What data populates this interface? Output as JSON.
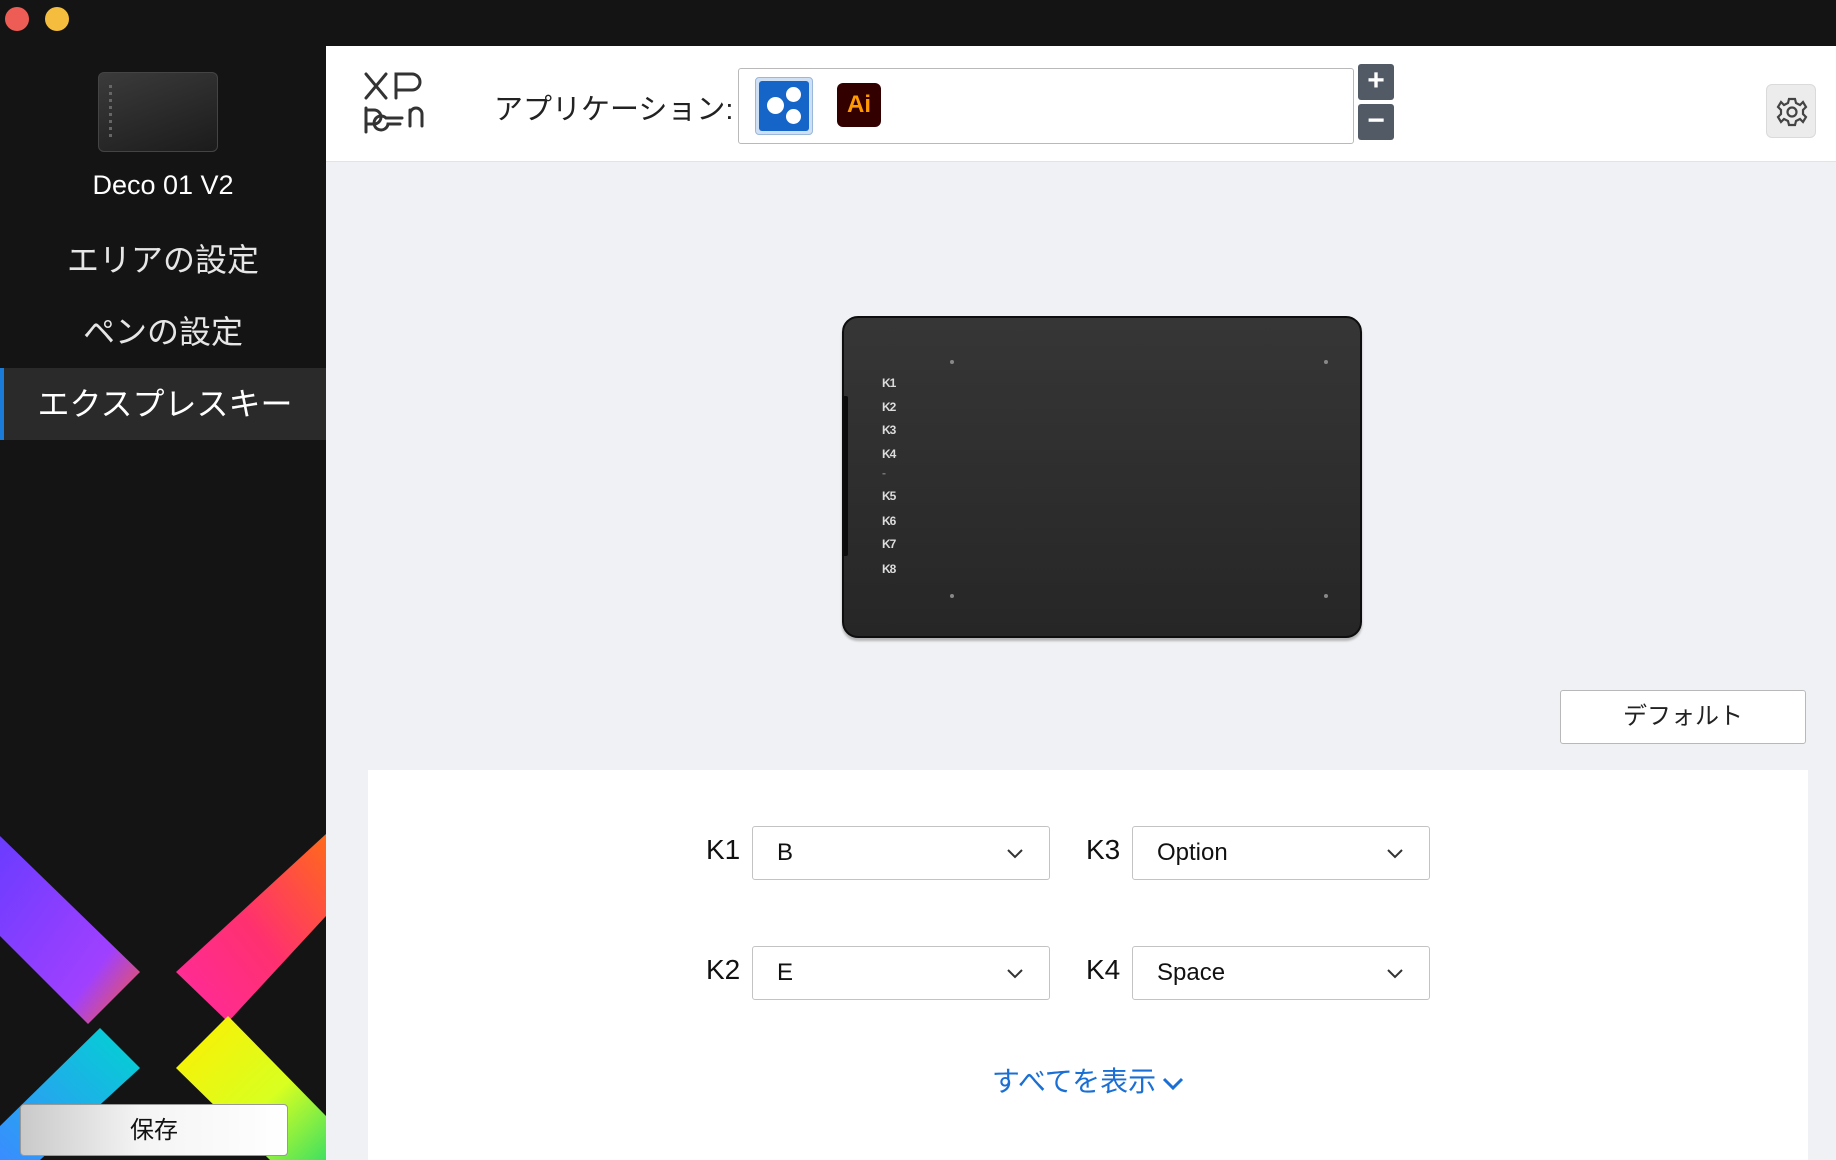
{
  "window": {
    "controls": [
      "close",
      "minimize"
    ]
  },
  "sidebar": {
    "device_name": "Deco 01 V2",
    "items": [
      {
        "label": "エリアの設定",
        "active": false
      },
      {
        "label": "ペンの設定",
        "active": false
      },
      {
        "label": "エクスプレスキー",
        "active": true
      }
    ],
    "save_label": "保存",
    "accent_colors": [
      "#7b3cff",
      "#ff2d8a",
      "#ff6a00",
      "#00c2ff",
      "#ffee00",
      "#4cd964"
    ]
  },
  "header": {
    "logo_top": "XP",
    "logo_bottom": "pen",
    "app_label": "アプリケーション:",
    "apps": [
      {
        "name": "all-apps-icon",
        "selected": true
      },
      {
        "name": "illustrator-icon",
        "text": "Ai",
        "selected": false
      }
    ],
    "add_label": "+",
    "remove_label": "−",
    "settings_icon": "gear-icon"
  },
  "tablet": {
    "keys": [
      "K1",
      "K2",
      "K3",
      "K4",
      "K5",
      "K6",
      "K7",
      "K8"
    ],
    "divider": "-"
  },
  "default_label": "デフォルト",
  "keys": {
    "k1": {
      "label": "K1",
      "value": "B"
    },
    "k2": {
      "label": "K2",
      "value": "E"
    },
    "k3": {
      "label": "K3",
      "value": "Option"
    },
    "k4": {
      "label": "K4",
      "value": "Space"
    }
  },
  "show_all_label": "すべてを表示",
  "accent": "#1b7bd8"
}
